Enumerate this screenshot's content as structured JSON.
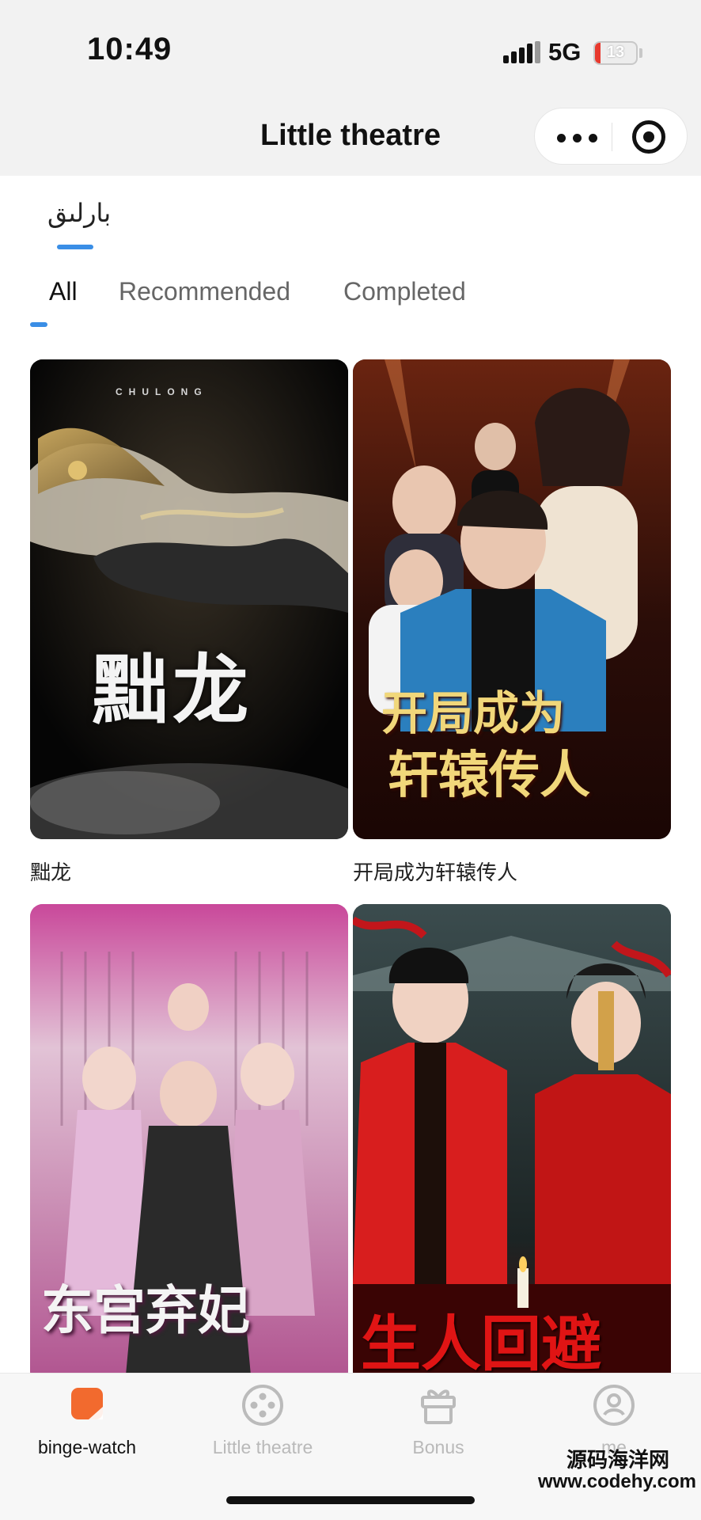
{
  "status_bar": {
    "time": "10:49",
    "network": "5G",
    "battery": "13",
    "battery_level": 0.13
  },
  "header": {
    "title": "Little theatre"
  },
  "category_tabs": [
    {
      "label": "بارلىق",
      "active": true
    }
  ],
  "filter_tabs": [
    {
      "label": "All",
      "active": true
    },
    {
      "label": "Recommended",
      "active": false
    },
    {
      "label": "Completed",
      "active": false
    }
  ],
  "dramas": [
    {
      "title": "黜龙",
      "poster_text": "黜龙",
      "poster_small": "CHULONG"
    },
    {
      "title": "开局成为轩辕传人",
      "poster_text": "开局成为",
      "poster_text_2": "轩辕传人"
    },
    {
      "title": "东宫弃妃",
      "poster_text": "东宫弃妃"
    },
    {
      "title": "生人回避",
      "poster_text": "生人回避"
    }
  ],
  "bottom_tabs": [
    {
      "label": "binge-watch",
      "icon": "play-square-icon",
      "active": true
    },
    {
      "label": "Little theatre",
      "icon": "film-reel-icon",
      "active": false
    },
    {
      "label": "Bonus",
      "icon": "gift-icon",
      "active": false
    },
    {
      "label": "me",
      "icon": "profile-icon",
      "active": false
    }
  ],
  "watermark": {
    "text_cn": "源码海洋网",
    "url": "www.codehy.com"
  },
  "colors": {
    "accent": "#3a8ee6",
    "active_tab_icon": "#f26a2e",
    "battery_low": "#e8392e"
  }
}
